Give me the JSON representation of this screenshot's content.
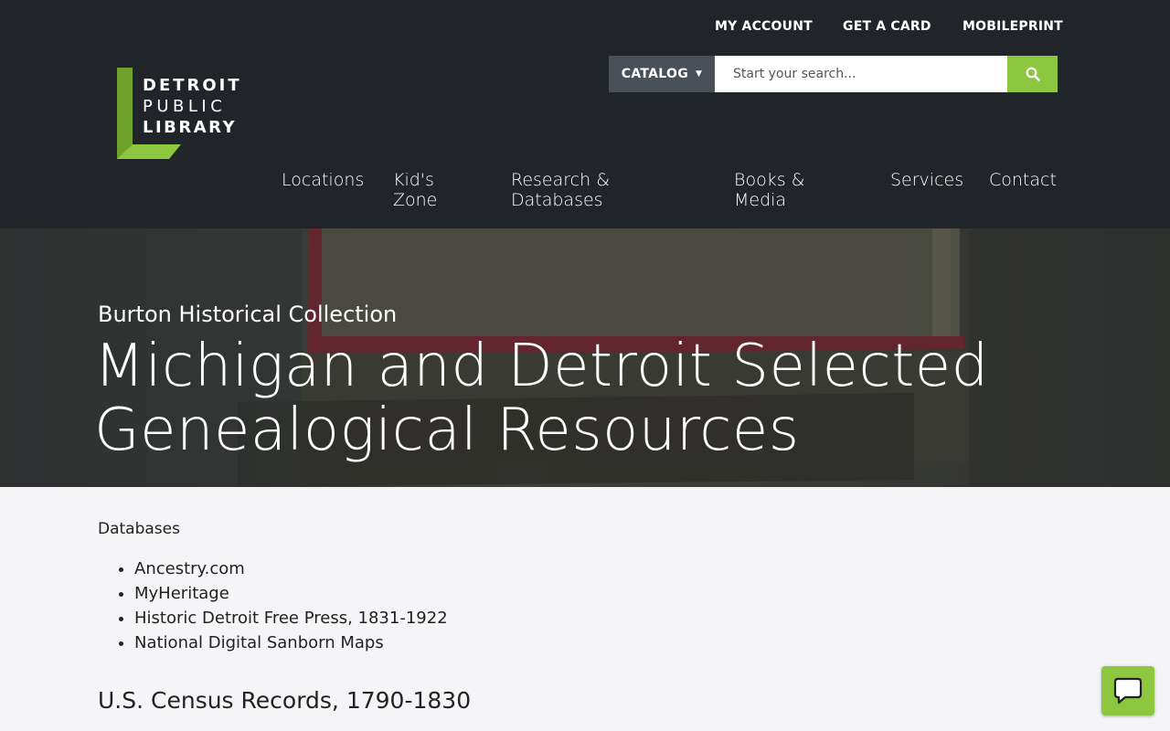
{
  "header": {
    "utility_links": [
      "MY ACCOUNT",
      "GET A CARD",
      "MOBILEPRINT"
    ],
    "logo": {
      "line1": "DETROIT",
      "line2": "PUBLIC",
      "line3": "LIBRARY"
    },
    "search": {
      "catalog_label": "CATALOG",
      "placeholder": "Start your search..."
    },
    "nav": {
      "locations": "Locations",
      "kids_zone": [
        "Kid's",
        "Zone"
      ],
      "research": [
        "Research &",
        "Databases"
      ],
      "books": [
        "Books &",
        "Media"
      ],
      "services": "Services",
      "contact": "Contact"
    }
  },
  "hero": {
    "subtitle": "Burton Historical Collection",
    "title": "Michigan and Detroit Selected Genealogical Resources"
  },
  "content": {
    "section_label": "Databases",
    "databases": [
      "Ancestry.com",
      "MyHeritage",
      "Historic Detroit Free Press, 1831-1922",
      "National Digital Sanborn Maps"
    ],
    "census_heading": "U.S. Census Records, 1790-1830"
  },
  "colors": {
    "header_bg": "#212429",
    "accent_green": "#8dc63f",
    "catalog_bg": "#4a5058",
    "page_bg": "#f5f5f7"
  },
  "icons": {
    "search": "search-icon",
    "chat": "chat-icon",
    "caret": "chevron-down-icon"
  }
}
